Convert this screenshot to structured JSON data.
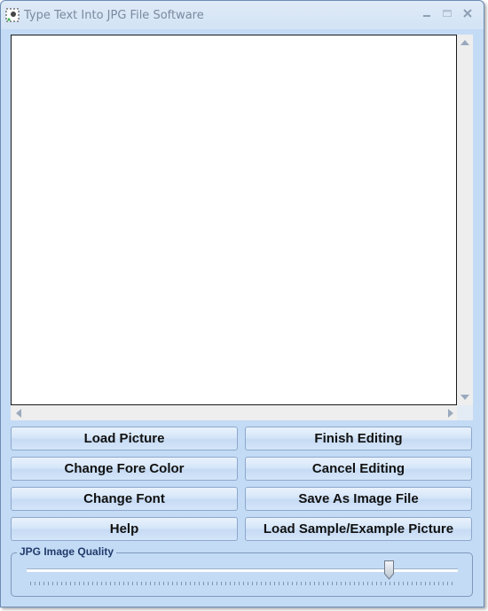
{
  "window": {
    "title": "Type Text Into JPG File Software",
    "controls": [
      "minimize",
      "maximize",
      "close"
    ],
    "accent": "#c4dbf5"
  },
  "buttons": {
    "load_picture": "Load Picture",
    "finish_editing": "Finish Editing",
    "change_fore_color": "Change Fore Color",
    "cancel_editing": "Cancel Editing",
    "change_font": "Change Font",
    "save_as_image_file": "Save As Image File",
    "help": "Help",
    "load_sample": "Load Sample/Example Picture"
  },
  "quality": {
    "label": "JPG Image Quality",
    "value_fraction": 0.84
  }
}
